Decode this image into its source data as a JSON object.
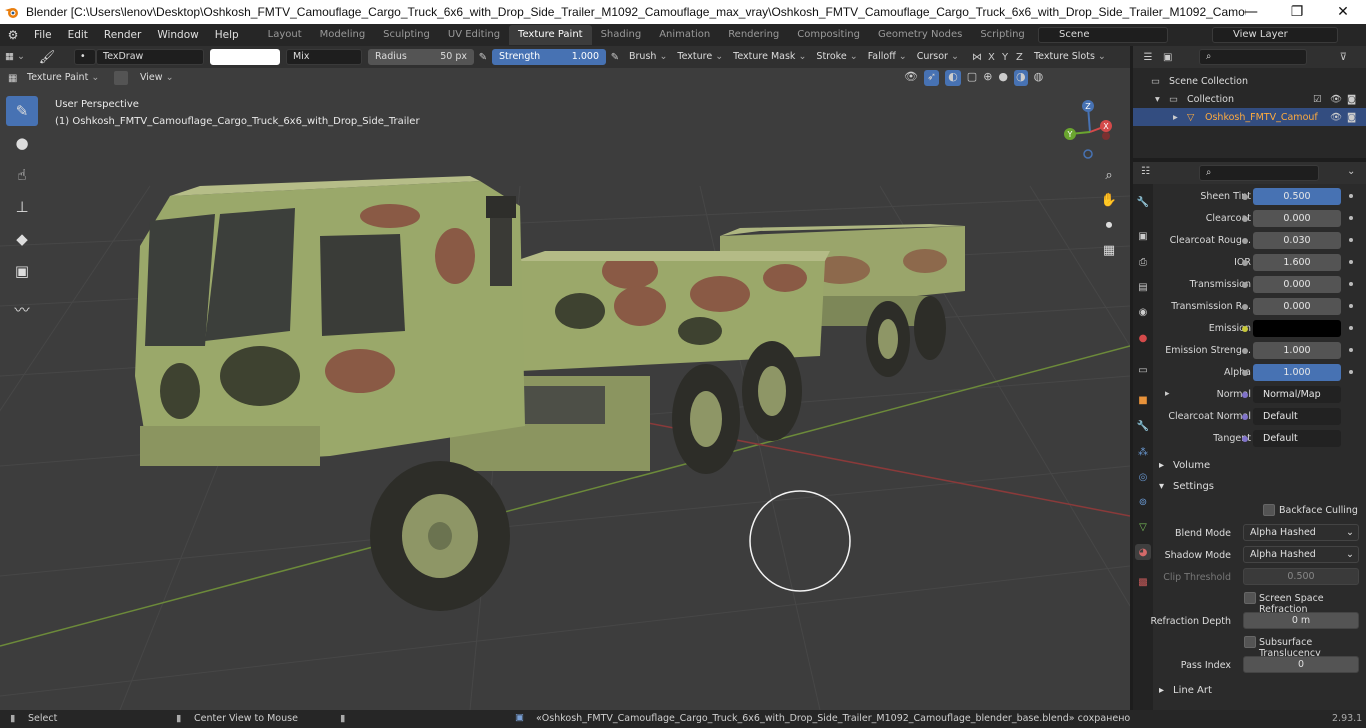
{
  "window": {
    "title": "Blender [C:\\Users\\lenov\\Desktop\\Oshkosh_FMTV_Camouflage_Cargo_Truck_6x6_with_Drop_Side_Trailer_M1092_Camouflage_max_vray\\Oshkosh_FMTV_Camouflage_Cargo_Truck_6x6_with_Drop_Side_Trailer_M1092_Camouflage...",
    "minimize": "—",
    "maximize": "❐",
    "close": "✕"
  },
  "menu": [
    "File",
    "Edit",
    "Render",
    "Window",
    "Help"
  ],
  "workspaces": [
    "Layout",
    "Modeling",
    "Sculpting",
    "UV Editing",
    "Texture Paint",
    "Shading",
    "Animation",
    "Rendering",
    "Compositing",
    "Geometry Nodes",
    "Scripting"
  ],
  "active_workspace": "Texture Paint",
  "scene": {
    "label": "Scene",
    "view_layer": "View Layer"
  },
  "tool_header": {
    "brush_name": "TexDraw",
    "blend_mode": "Mix",
    "radius_label": "Radius",
    "radius_value": "50 px",
    "strength_label": "Strength",
    "strength_value": "1.000",
    "menus": [
      "Brush",
      "Texture",
      "Texture Mask",
      "Stroke",
      "Falloff",
      "Cursor"
    ],
    "axes": [
      "X",
      "Y",
      "Z"
    ],
    "texture_slots": "Texture Slots"
  },
  "viewport_header": {
    "mode": "Texture Paint",
    "view_menu": "View"
  },
  "viewport": {
    "perspective": "User Perspective",
    "object_name": "(1) Oshkosh_FMTV_Camouflage_Cargo_Truck_6x6_with_Drop_Side_Trailer",
    "gizmo_axes": [
      "X",
      "Y",
      "Z"
    ]
  },
  "tools": [
    {
      "name": "draw-tool",
      "glyph": "✎"
    },
    {
      "name": "soften-tool",
      "glyph": "●"
    },
    {
      "name": "smear-tool",
      "glyph": "☝"
    },
    {
      "name": "clone-tool",
      "glyph": "⊥"
    },
    {
      "name": "fill-tool",
      "glyph": "◆"
    },
    {
      "name": "mask-tool",
      "glyph": "▣"
    },
    {
      "name": "annotate-tool",
      "glyph": "〰"
    }
  ],
  "outliner": {
    "root": "Scene Collection",
    "collection": "Collection",
    "object": "Oshkosh_FMTV_Camouf"
  },
  "properties": {
    "rows": [
      {
        "label": "Sheen Tint",
        "value": "0.500",
        "style": "blue"
      },
      {
        "label": "Clearcoat",
        "value": "0.000",
        "style": "grey"
      },
      {
        "label": "Clearcoat Roug...",
        "value": "0.030",
        "style": "grey"
      },
      {
        "label": "IOR",
        "value": "1.600",
        "style": "grey"
      },
      {
        "label": "Transmission",
        "value": "0.000",
        "style": "grey"
      },
      {
        "label": "Transmission R...",
        "value": "0.000",
        "style": "grey"
      },
      {
        "label": "Emission",
        "value": "",
        "style": "black"
      },
      {
        "label": "Emission Streng...",
        "value": "1.000",
        "style": "grey"
      },
      {
        "label": "Alpha",
        "value": "1.000",
        "style": "blue"
      },
      {
        "label": "Normal",
        "value": "Normal/Map",
        "style": "dark"
      },
      {
        "label": "Clearcoat Normal",
        "value": "Default",
        "style": "dark"
      },
      {
        "label": "Tangent",
        "value": "Default",
        "style": "dark"
      }
    ],
    "sections": {
      "volume": "Volume",
      "settings": "Settings",
      "line_art": "Line Art"
    },
    "settings": {
      "backface_culling": "Backface Culling",
      "blend_mode_label": "Blend Mode",
      "blend_mode_value": "Alpha Hashed",
      "shadow_mode_label": "Shadow Mode",
      "shadow_mode_value": "Alpha Hashed",
      "clip_threshold_label": "Clip Threshold",
      "clip_threshold_value": "0.500",
      "screen_space_refraction": "Screen Space Refraction",
      "refraction_depth_label": "Refraction Depth",
      "refraction_depth_value": "0 m",
      "subsurface_translucency": "Subsurface Translucency",
      "pass_index_label": "Pass Index",
      "pass_index_value": "0"
    }
  },
  "statusbar": {
    "select": "Select",
    "center_view": "Center View to Mouse",
    "message": "«Oshkosh_FMTV_Camouflage_Cargo_Truck_6x6_with_Drop_Side_Trailer_M1092_Camouflage_blender_base.blend» сохранено",
    "version": "2.93.1"
  },
  "colors": {
    "accent": "#4772b3",
    "selection_text": "#ffab3d",
    "viewport_bg": "#3d3d3d",
    "camo_green": "#9aa86a",
    "camo_brown": "#8a5a45",
    "camo_dark": "#3e4230"
  }
}
